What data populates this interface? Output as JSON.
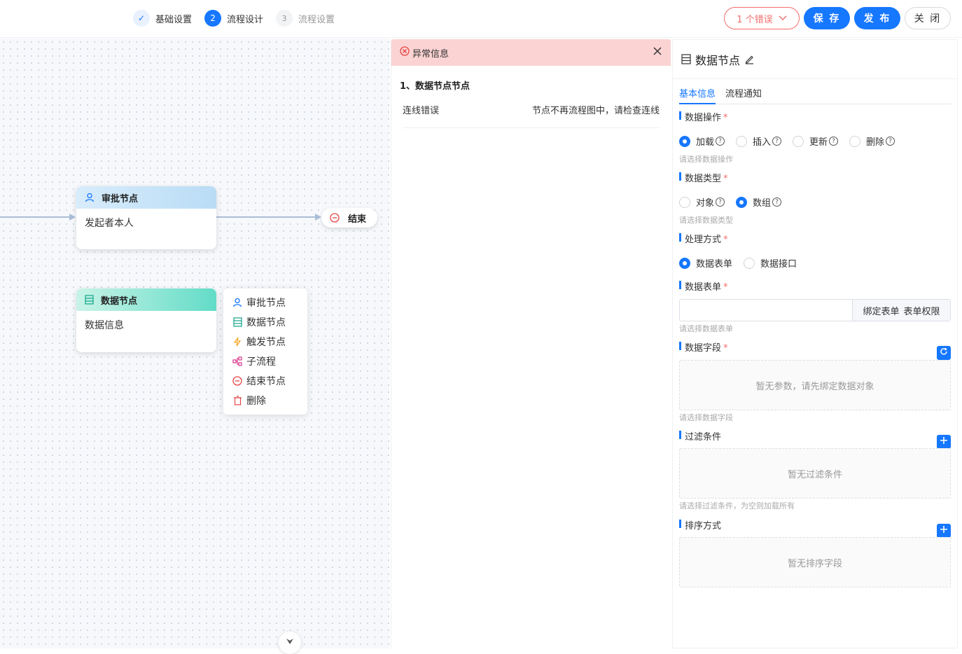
{
  "steps": [
    {
      "index": "✓",
      "label": "基础设置",
      "state": "done"
    },
    {
      "index": "2",
      "label": "流程设计",
      "state": "active"
    },
    {
      "index": "3",
      "label": "流程设置",
      "state": "todo"
    }
  ],
  "header": {
    "error_label": "1 个错误",
    "save_label": "保 存",
    "publish_label": "发 布",
    "close_label": "关 闭"
  },
  "canvas": {
    "approve_node": {
      "title": "审批节点",
      "body": "发起者本人",
      "icon": "user-icon"
    },
    "data_node": {
      "title": "数据节点",
      "body": "数据信息",
      "icon": "table-icon"
    },
    "end_node": {
      "title": "结束",
      "icon": "minus-circle-icon"
    },
    "context_menu": [
      {
        "label": "审批节点",
        "icon": "user-icon",
        "color": "#1677ff"
      },
      {
        "label": "数据节点",
        "icon": "table-icon",
        "color": "#13a58a"
      },
      {
        "label": "触发节点",
        "icon": "lightning-icon",
        "color": "#f5a623"
      },
      {
        "label": "子流程",
        "icon": "subflow-icon",
        "color": "#d9368b"
      },
      {
        "label": "结束节点",
        "icon": "minus-circle-icon",
        "color": "#e64545"
      },
      {
        "label": "删除",
        "icon": "trash-icon",
        "color": "#e64545"
      }
    ]
  },
  "error_panel": {
    "title": "异常信息",
    "item_title": "1、数据节点节点",
    "error_type": "连线错误",
    "error_detail": "节点不再流程图中，请检查连线"
  },
  "props": {
    "title": "数据节点",
    "tabs": [
      "基本信息",
      "流程通知"
    ],
    "data_op": {
      "label": "数据操作",
      "options": [
        "加载",
        "插入",
        "更新",
        "删除"
      ],
      "selected": 0,
      "hint": "请选择数据操作"
    },
    "data_type": {
      "label": "数据类型",
      "options": [
        "对象",
        "数组"
      ],
      "selected": 1,
      "hint": "请选择数据类型"
    },
    "process": {
      "label": "处理方式",
      "options": [
        "数据表单",
        "数据接口"
      ],
      "selected": 0
    },
    "data_form": {
      "label": "数据表单",
      "bind_label": "绑定表单",
      "perm_label": "表单权限",
      "hint": "请选择数据表单"
    },
    "data_fields": {
      "label": "数据字段",
      "empty": "暂无参数，请先绑定数据对象",
      "hint": "请选择数据字段"
    },
    "filter": {
      "label": "过滤条件",
      "empty": "暂无过滤条件",
      "hint": "请选择过滤条件，为空则加载所有"
    },
    "sort": {
      "label": "排序方式",
      "empty": "暂无排序字段"
    }
  }
}
